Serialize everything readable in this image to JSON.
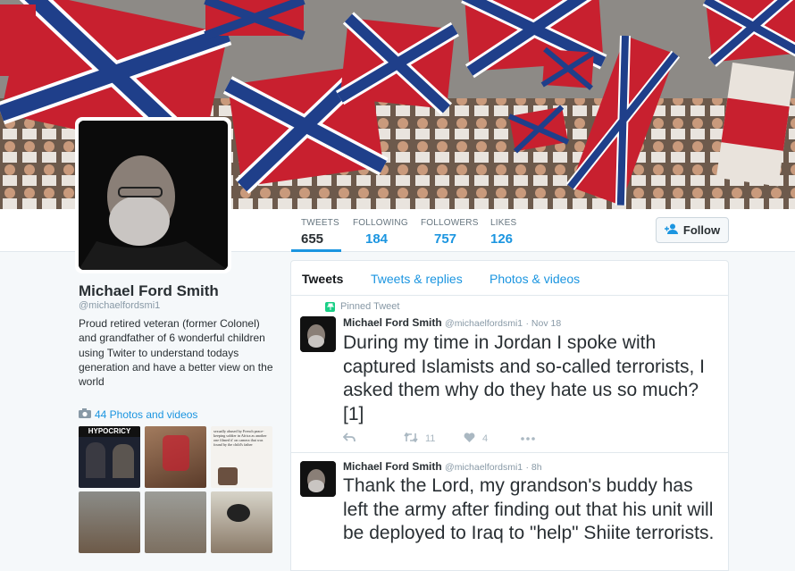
{
  "profile": {
    "name": "Michael Ford Smith",
    "handle": "@michaelfordsmi1",
    "bio": "Proud retired veteran (former Colonel) and grandfather of 6 wonderful children using Twiter to understand todays generation and have a better view on the world",
    "photos_label": "44 Photos and videos",
    "thumb_texts": {
      "hypocricy": "HYPOCRICY",
      "article": "sexually abused by French peace-keeping soldier in Africa as another one filmed it' on camera that was found by the child's father"
    }
  },
  "stats": [
    {
      "label": "TWEETS",
      "value": "655"
    },
    {
      "label": "FOLLOWING",
      "value": "184"
    },
    {
      "label": "FOLLOWERS",
      "value": "757"
    },
    {
      "label": "LIKES",
      "value": "126"
    }
  ],
  "follow_label": "Follow",
  "tabs": [
    "Tweets",
    "Tweets & replies",
    "Photos & videos"
  ],
  "tweets": [
    {
      "pinned_label": "Pinned Tweet",
      "name": "Michael Ford Smith",
      "handle": "@michaelfordsmi1",
      "time": "· Nov 18",
      "text": "During my time in Jordan I spoke with captured Islamists and so-called terrorists, I asked them why do they hate us so much? [1]",
      "retweets": "11",
      "likes": "4"
    },
    {
      "name": "Michael Ford Smith",
      "handle": "@michaelfordsmi1",
      "time": "· 8h",
      "text": "Thank the Lord, my grandson's buddy has left the army after finding out that his unit will be deployed to Iraq to \"help\" Shiite terrorists."
    }
  ],
  "colors": {
    "accent": "#1b95e0",
    "pin_green": "#19cf86",
    "flag_red": "#c8202f",
    "flag_blue": "#1f3f8a"
  }
}
